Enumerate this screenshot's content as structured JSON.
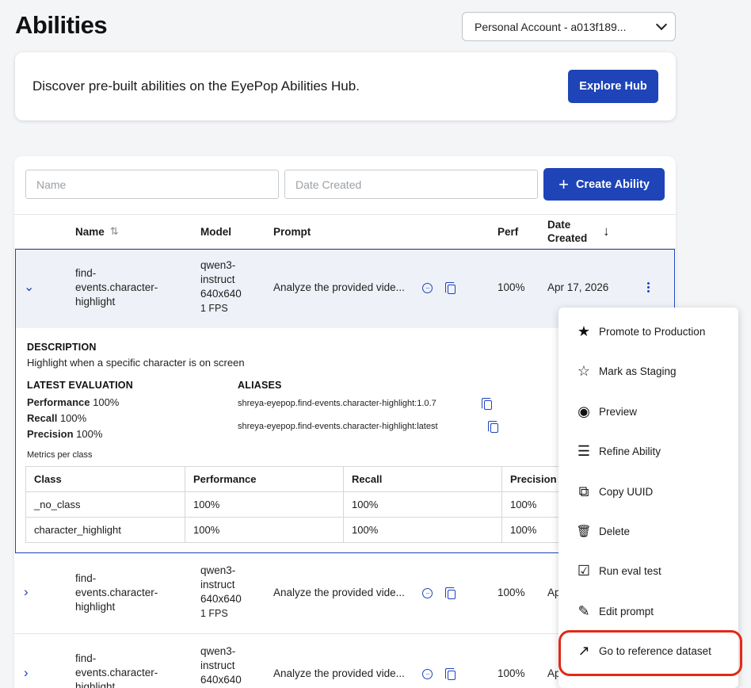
{
  "page": {
    "title": "Abilities"
  },
  "account": {
    "label": "Personal Account - a013f189..."
  },
  "hub": {
    "text": "Discover pre-built abilities on the EyePop Abilities Hub.",
    "button": "Explore Hub"
  },
  "filters": {
    "name_placeholder": "Name",
    "date_placeholder": "Date Created",
    "create_label": "Create Ability",
    "create_icon": "+"
  },
  "table": {
    "headers": {
      "name": "Name",
      "model": "Model",
      "prompt": "Prompt",
      "perf": "Perf",
      "date_line1": "Date",
      "date_line2": "Created"
    },
    "sort_icons": {
      "name": "⇅",
      "date": "↓"
    },
    "rows": [
      {
        "name_l1": "find-",
        "name_l2": "events.character-",
        "name_l3": "highlight",
        "model_l1": "qwen3-",
        "model_l2": "instruct",
        "model_l3": "640x640",
        "model_l4": "1 FPS",
        "prompt": "Analyze the provided vide...",
        "perf": "100%",
        "date": "Apr 17, 2026",
        "expand_icon": "⌄"
      },
      {
        "name_l1": "find-",
        "name_l2": "events.character-",
        "name_l3": "highlight",
        "model_l1": "qwen3-",
        "model_l2": "instruct",
        "model_l3": "640x640",
        "model_l4": "1 FPS",
        "prompt": "Analyze the provided vide...",
        "perf": "100%",
        "date": "Ap",
        "expand_icon": "›"
      },
      {
        "name_l1": "find-",
        "name_l2": "events.character-",
        "name_l3": "highlight",
        "model_l1": "qwen3-",
        "model_l2": "instruct",
        "model_l3": "640x640",
        "prompt": "Analyze the provided vide...",
        "perf": "100%",
        "date": "Ap",
        "expand_icon": "›"
      }
    ]
  },
  "details": {
    "description_heading": "DESCRIPTION",
    "description": "Highlight when a specific character is on screen",
    "latest_eval_heading": "LATEST EVALUATION",
    "performance_label": "Performance",
    "performance_value": "100%",
    "recall_label": "Recall",
    "recall_value": "100%",
    "precision_label": "Precision",
    "precision_value": "100%",
    "aliases_heading": "ALIASES",
    "alias_1": "shreya-eyepop.find-events.character-highlight:1.0.7",
    "alias_2": "shreya-eyepop.find-events.character-highlight:latest",
    "metrics_caption": "Metrics per class",
    "metrics_headers": {
      "class": "Class",
      "performance": "Performance",
      "recall": "Recall",
      "precision": "Precision"
    },
    "metrics_rows": [
      {
        "class": "_no_class",
        "performance": "100%",
        "recall": "100%",
        "precision": "100%"
      },
      {
        "class": "character_highlight",
        "performance": "100%",
        "recall": "100%",
        "precision": "100%"
      }
    ]
  },
  "menu": {
    "items": [
      {
        "label": "Promote to Production",
        "icon": "star-filled-icon",
        "glyph": "★"
      },
      {
        "label": "Mark as Staging",
        "icon": "star-outline-icon",
        "glyph": "☆"
      },
      {
        "label": "Preview",
        "icon": "eye-icon",
        "glyph": "◉"
      },
      {
        "label": "Refine Ability",
        "icon": "sliders-icon",
        "glyph": "☰"
      },
      {
        "label": "Copy UUID",
        "icon": "copy-icon",
        "glyph": "⧉"
      },
      {
        "label": "Delete",
        "icon": "trash-icon",
        "glyph": "🗑"
      },
      {
        "label": "Run eval test",
        "icon": "checklist-icon",
        "glyph": "☑"
      },
      {
        "label": "Edit prompt",
        "icon": "pencil-icon",
        "glyph": "✎"
      },
      {
        "label": "Go to reference dataset",
        "icon": "external-link-icon",
        "glyph": "↗"
      }
    ]
  },
  "colors": {
    "primary": "#1e44b8",
    "highlight": "#e02a17"
  }
}
